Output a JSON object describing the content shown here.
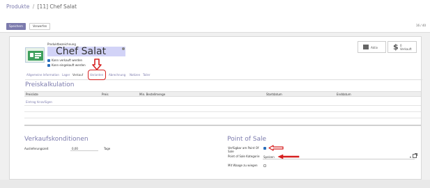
{
  "header": {
    "breadcrumb_parent": "Produkte",
    "breadcrumb_separator": "/",
    "breadcrumb_current": "[11] Chef Salat",
    "pager": "16 / 40"
  },
  "toolbar": {
    "save_label": "Speichern",
    "discard_label": "Verwerfen"
  },
  "product": {
    "name_label": "Produktbezeichnung",
    "name": "Chef Salat",
    "image_icon": "product-card-icon",
    "can_be_sold_label": "Kann verkauft werden",
    "can_be_purchased_label": "Kann eingekauft werden",
    "can_be_sold": true,
    "can_be_purchased": true
  },
  "stats": {
    "active_label": "Aktiv",
    "active_icon": "archive-icon",
    "sold_value": "0",
    "sold_label": "Verkauft",
    "sold_icon": "dollar-icon"
  },
  "tabs": [
    {
      "label": "Allgemeine Information",
      "active": false
    },
    {
      "label": "Lager",
      "active": false
    },
    {
      "label": "Verkauf",
      "active": true
    },
    {
      "label": "Varianten",
      "active": false
    },
    {
      "label": "Abrechnung",
      "active": false
    },
    {
      "label": "Notizen",
      "active": false
    },
    {
      "label": "Toiler",
      "active": false
    }
  ],
  "pricing": {
    "title": "Preiskalkulation",
    "columns": [
      "Preisliste",
      "Preis",
      "Min. Bestellmenge",
      "Startdatum",
      "Enddatum"
    ],
    "add_line": "Eintrag hinzufügen"
  },
  "sales_conditions": {
    "title": "Verkaufskonditionen",
    "lead_time_label": "Auslieferungszeit",
    "lead_time_value": "0,00",
    "lead_time_unit": "Tage"
  },
  "pos": {
    "title": "Point of Sale",
    "available_label": "Verfügbar am Point Of Sale",
    "available": true,
    "category_label": "Point of Sale Kategorie",
    "category_value": "Speisen",
    "to_weigh_label": "Mit Waage zu wiegen",
    "to_weigh": false
  },
  "colors": {
    "accent": "#7c7bad",
    "name_highlight": "#d2d3f7",
    "annotation": "#d62020",
    "checkbox": "#2a6ebb"
  }
}
